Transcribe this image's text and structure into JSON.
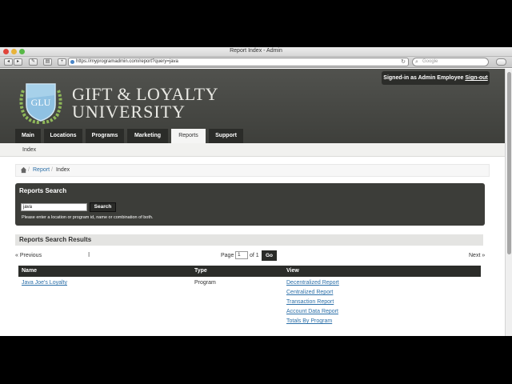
{
  "window": {
    "title": "Report Index - Admin",
    "url": "https://myprogramadmin.com/report?query=java",
    "search_placeholder": "Google"
  },
  "header": {
    "signin_text": "Signed-in as Admin Employee",
    "signout_label": "Sign-out",
    "logo_text": "GLU",
    "brand_line1": "GIFT & LOYALTY",
    "brand_line2": "UNIVERSITY"
  },
  "nav": {
    "tabs": [
      {
        "label": "Main"
      },
      {
        "label": "Locations"
      },
      {
        "label": "Programs"
      },
      {
        "label": "Marketing"
      },
      {
        "label": "Reports"
      },
      {
        "label": "Support"
      }
    ],
    "active_tab": "Reports"
  },
  "subnav": {
    "item": "Index"
  },
  "breadcrumb": {
    "link": "Report",
    "current": "Index"
  },
  "search": {
    "title": "Reports Search",
    "value": "java",
    "button": "Search",
    "help": "Please enter a location or program id, name or combination of both."
  },
  "results": {
    "title": "Reports Search Results",
    "previous": "« Previous",
    "page_label": "Page",
    "page_value": "1",
    "of_label": "of 1",
    "go_button": "Go",
    "next": "Next »",
    "columns": [
      "Name",
      "Type",
      "View"
    ],
    "rows": [
      {
        "name": "Java Joe's Loyalty",
        "type": "Program",
        "views": [
          "Decentralized Report",
          "Centralized Report",
          "Transaction Report",
          "Account Data Report",
          "Totals By Program"
        ]
      }
    ]
  }
}
